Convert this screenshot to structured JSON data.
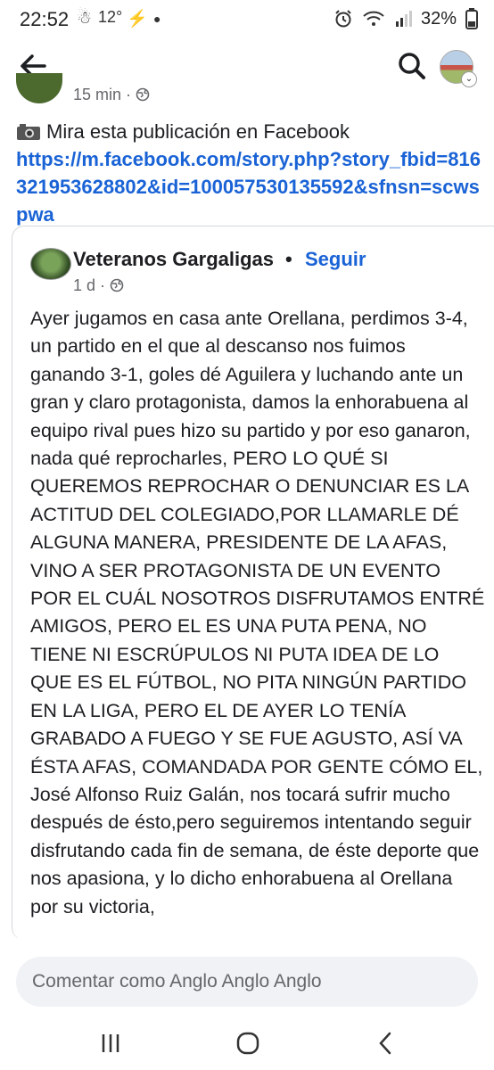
{
  "status_bar": {
    "time": "22:52",
    "temp": "12°",
    "battery": "32%",
    "icons": [
      "alarm-icon",
      "wifi-icon",
      "signal-icon",
      "battery-icon"
    ]
  },
  "top_bar": {
    "icons": [
      "back-arrow-icon",
      "search-icon",
      "profile-avatar"
    ]
  },
  "comment": {
    "time": "15 min",
    "text": "Mira esta publicación en Facebook",
    "link": "https://m.facebook.com/story.php?story_fbid=816321953628802&id=100057530135592&sfnsn=scwspwa"
  },
  "post": {
    "author": "Veteranos Gargaligas",
    "separator": "•",
    "follow_label": "Seguir",
    "time": "1 d",
    "body": "Ayer jugamos en casa ante Orellana, perdimos 3-4, un partido en el que al descanso nos fuimos ganando 3-1, goles dé Aguilera y luchando ante un gran y claro protagonista, damos la enhorabuena al equipo rival pues hizo su partido y por eso ganaron, nada qué reprocharles, PERO LO QUÉ SI QUEREMOS REPROCHAR O DENUNCIAR ES LA ACTITUD DEL COLEGIADO,POR LLAMARLE DÉ ALGUNA MANERA, PRESIDENTE DE LA AFAS, VINO A SER PROTAGONISTA DE UN EVENTO POR EL CUÁL NOSOTROS DISFRUTAMOS ENTRÉ AMIGOS, PERO EL ES UNA PUTA PENA, NO TIENE NI ESCRÚPULOS NI PUTA IDEA DE LO QUE ES EL FÚTBOL, NO PITA NINGÚN PARTIDO EN LA LIGA, PERO EL DE AYER LO TENÍA GRABADO A FUEGO Y SE FUE AGUSTO, ASÍ VA ÉSTA AFAS, COMANDADA POR GENTE CÓMO EL, José Alfonso Ruiz Galán, nos tocará sufrir mucho después de ésto,pero seguiremos intentando seguir disfrutando cada fin de semana, de éste deporte que nos apasiona, y lo dicho enhorabuena al Orellana por su victoria,"
  },
  "comment_box": {
    "placeholder": "Comentar como Anglo Anglo Anglo"
  },
  "nav_bar": {
    "icons": [
      "recent-apps-icon",
      "home-icon",
      "back-icon"
    ]
  },
  "colors": {
    "link": "#1a63d6",
    "meta": "#65676b",
    "input_bg": "#f0f2f5"
  }
}
